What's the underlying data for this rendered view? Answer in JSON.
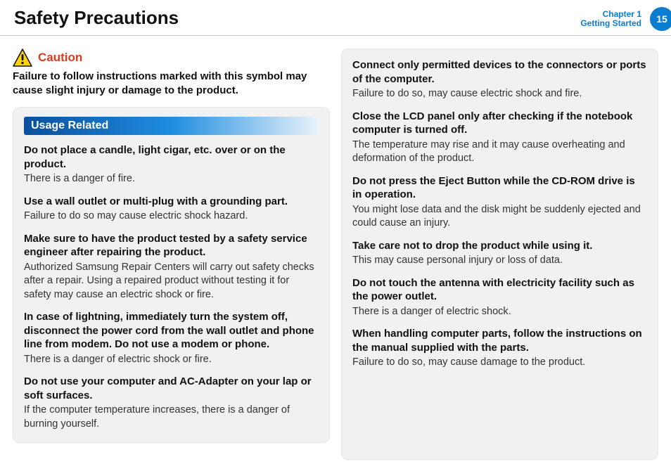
{
  "header": {
    "title": "Safety Precautions",
    "chapter": "Chapter 1",
    "section": "Getting Started",
    "page": "15"
  },
  "caution": {
    "label": "Caution",
    "desc": "Failure to follow instructions marked with this symbol may cause slight injury or damage to the product."
  },
  "usage": {
    "heading": "Usage Related",
    "items": [
      {
        "h": "Do not place a candle, light cigar, etc. over or on the product.",
        "b": "There is a danger of fire."
      },
      {
        "h": "Use a wall outlet or multi-plug with a grounding part.",
        "b": "Failure to do so may cause electric shock hazard."
      },
      {
        "h": "Make sure to have the product tested by a safety service engineer after repairing the product.",
        "b": "Authorized Samsung Repair Centers will carry out safety checks after a repair. Using a repaired product without testing it for safety may cause an electric shock or fire."
      },
      {
        "h": "In case of lightning, immediately turn the system off, disconnect the power cord from the wall outlet and phone line from modem. Do not use a modem or phone.",
        "b": "There is a danger of electric shock or fire."
      },
      {
        "h": "Do not use your computer and AC-Adapter on your lap or soft surfaces.",
        "b": "If the computer temperature increases, there is a danger of burning yourself."
      }
    ]
  },
  "right_items": [
    {
      "h": "Connect only permitted devices to the connectors or ports of the computer.",
      "b": "Failure to do so, may cause electric shock and fire."
    },
    {
      "h": "Close the LCD panel only after checking if the notebook computer is turned off.",
      "b": "The temperature may rise and it may cause overheating and deformation of the product."
    },
    {
      "h": "Do not press the Eject Button while the CD-ROM drive is in operation.",
      "b": "You might lose data and the disk might be suddenly ejected and could cause an injury."
    },
    {
      "h": "Take care not to drop the product while using it.",
      "b": "This may cause personal injury or loss of data."
    },
    {
      "h": "Do not touch the antenna with electricity facility such as the power outlet.",
      "b": "There is a danger of electric shock."
    },
    {
      "h": "When handling computer parts, follow the instructions on the manual supplied with the parts.",
      "b": "Failure to do so, may cause damage to the product."
    }
  ]
}
